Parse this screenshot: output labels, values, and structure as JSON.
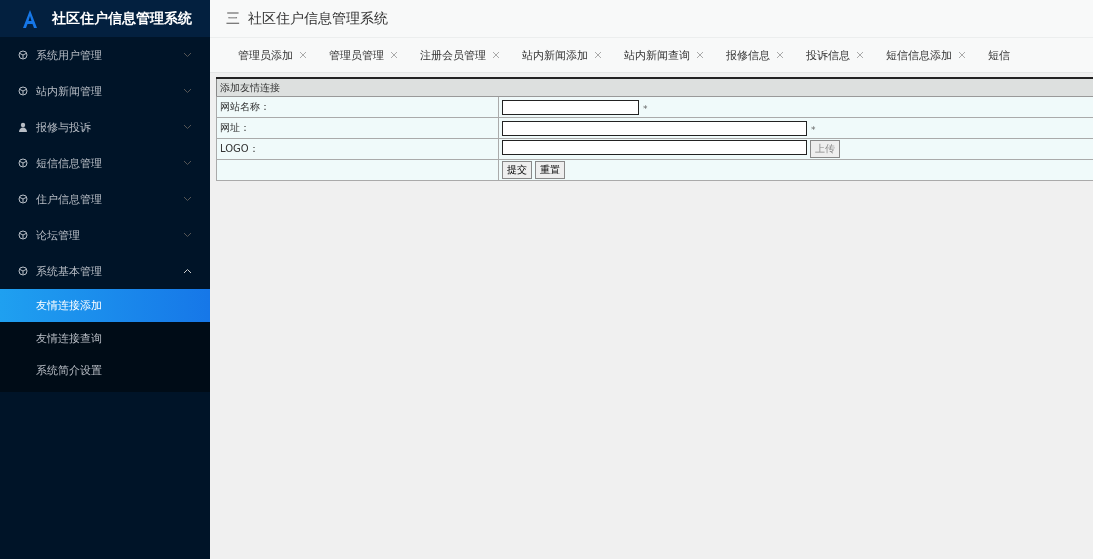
{
  "app": {
    "title": "社区住户信息管理系统"
  },
  "sidebar": {
    "items": [
      {
        "label": "系统用户管理",
        "expanded": false
      },
      {
        "label": "站内新闻管理",
        "expanded": false
      },
      {
        "label": "报修与投诉",
        "expanded": false
      },
      {
        "label": "短信信息管理",
        "expanded": false
      },
      {
        "label": "住户信息管理",
        "expanded": false
      },
      {
        "label": "论坛管理",
        "expanded": false
      },
      {
        "label": "系统基本管理",
        "expanded": true,
        "children": [
          {
            "label": "友情连接添加",
            "selected": true
          },
          {
            "label": "友情连接查询",
            "selected": false
          },
          {
            "label": "系统简介设置",
            "selected": false
          }
        ]
      }
    ]
  },
  "header": {
    "menu_icon": "三",
    "title": "社区住户信息管理系统"
  },
  "tabs": [
    {
      "label": "管理员添加",
      "closable": true
    },
    {
      "label": "管理员管理",
      "closable": true
    },
    {
      "label": "注册会员管理",
      "closable": true
    },
    {
      "label": "站内新闻添加",
      "closable": true
    },
    {
      "label": "站内新闻查询",
      "closable": true
    },
    {
      "label": "报修信息",
      "closable": true
    },
    {
      "label": "投诉信息",
      "closable": true
    },
    {
      "label": "短信信息添加",
      "closable": true
    },
    {
      "label": "短信",
      "closable": false
    }
  ],
  "form": {
    "title": "添加友情连接",
    "rows": [
      {
        "kind": "input",
        "label": "网站名称：",
        "required": "*"
      },
      {
        "kind": "input",
        "label": "网址：",
        "required": "*"
      },
      {
        "kind": "upload",
        "label": "LOGO：",
        "button": "上传"
      },
      {
        "kind": "actions",
        "buttons": [
          "提交",
          "重置"
        ]
      }
    ]
  }
}
